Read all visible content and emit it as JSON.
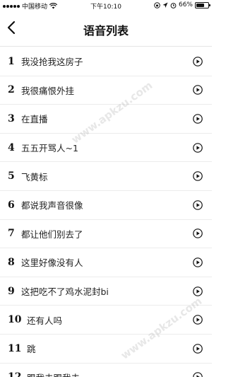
{
  "status_bar": {
    "carrier": "中国移动",
    "time": "下午10:10",
    "battery": "66%",
    "battery_level": 0.66
  },
  "nav": {
    "title": "语音列表",
    "back_icon": "chevron-left-icon"
  },
  "items": [
    {
      "num": "1",
      "text": "我没抢我这房子"
    },
    {
      "num": "2",
      "text": "我很痛恨外挂"
    },
    {
      "num": "3",
      "text": "在直播"
    },
    {
      "num": "4",
      "text": "五五开骂人~1"
    },
    {
      "num": "5",
      "text": "飞黄标"
    },
    {
      "num": "6",
      "text": "都说我声音很像"
    },
    {
      "num": "7",
      "text": "都让他们别去了"
    },
    {
      "num": "8",
      "text": "这里好像没有人"
    },
    {
      "num": "9",
      "text": "这把吃不了鸡水泥封bi"
    },
    {
      "num": "10",
      "text": "还有人吗"
    },
    {
      "num": "11",
      "text": "跳"
    },
    {
      "num": "12",
      "text": "跟我去跟我去"
    }
  ],
  "watermark": "www.apkzu.com"
}
